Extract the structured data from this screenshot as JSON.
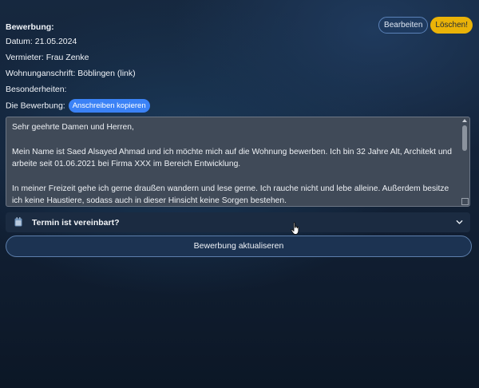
{
  "application": {
    "title": "Bewerbung:",
    "date": "Datum: 21.05.2024",
    "landlord": "Vermieter: Frau Zenke",
    "address": "Wohnunganschrift: Böblingen (link)",
    "notes": "Besonderheiten:",
    "letter_label": "Die Bewerbung:",
    "copy_button": "Anschreiben kopieren"
  },
  "actions": {
    "edit": "Bearbeiten",
    "delete": "Löschen!"
  },
  "letter": {
    "greeting": "Sehr geehrte Damen und Herren,",
    "paragraph1": "Mein Name ist Saed Alsayed Ahmad und ich möchte mich auf die Wohnung bewerben. Ich bin 32 Jahre Alt, Architekt und arbeite seit 01.06.2021 bei Firma XXX im Bereich Entwicklung.",
    "paragraph2": "In meiner Freizeit gehe ich gerne draußen wandern und lese gerne. Ich rauche nicht und lebe alleine. Außerdem besitze ich keine Haustiere, sodass auch in dieser Hinsicht keine Sorgen bestehen."
  },
  "accordion": {
    "label": "Termin ist vereinbart?",
    "icon": "calendar-icon",
    "expanded": false
  },
  "update_button": "Bewerbung aktualiseren",
  "colors": {
    "accent_blue": "#3b82f6",
    "delete_yellow": "#eab308"
  }
}
